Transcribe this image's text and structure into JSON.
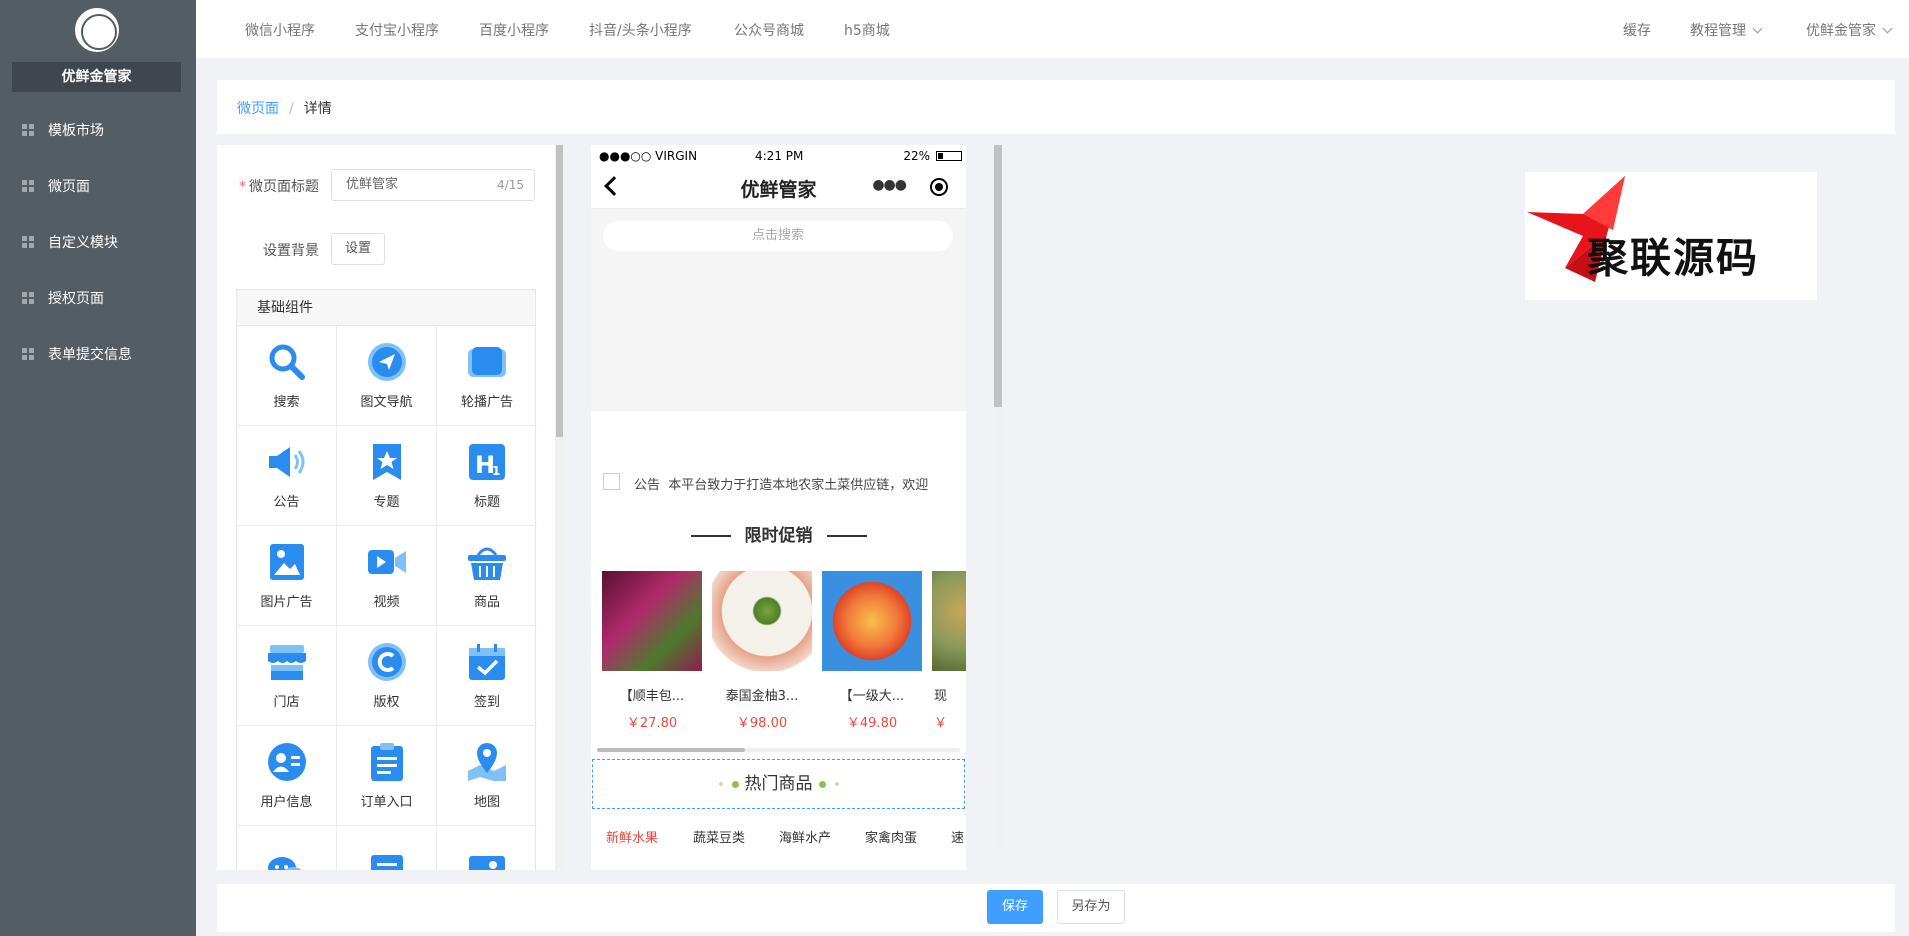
{
  "app": {
    "name": "优鲜金管家"
  },
  "sidebar": {
    "items": [
      {
        "label": "模板市场",
        "icon": "grid-icon"
      },
      {
        "label": "微页面",
        "icon": "grid-icon"
      },
      {
        "label": "自定义模块",
        "icon": "grid-icon"
      },
      {
        "label": "授权页面",
        "icon": "grid-icon"
      },
      {
        "label": "表单提交信息",
        "icon": "grid-icon"
      }
    ]
  },
  "topbar": {
    "tabs": [
      "微信小程序",
      "支付宝小程序",
      "百度小程序",
      "抖音/头条小程序",
      "公众号商城",
      "h5商城"
    ],
    "cache": "缓存",
    "tutorial": "教程管理",
    "user": "优鲜金管家"
  },
  "breadcrumb": {
    "parent": "微页面",
    "separator": "/",
    "current": "详情"
  },
  "form": {
    "title_label": "微页面标题",
    "title_value": "优鲜管家",
    "title_count": "4/15",
    "bg_label": "设置背景",
    "bg_button": "设置"
  },
  "components": {
    "header": "基础组件",
    "items": [
      {
        "label": "搜索",
        "icon": "search-icon"
      },
      {
        "label": "图文导航",
        "icon": "navigation-icon"
      },
      {
        "label": "轮播广告",
        "icon": "carousel-icon"
      },
      {
        "label": "公告",
        "icon": "speaker-icon"
      },
      {
        "label": "专题",
        "icon": "star-icon"
      },
      {
        "label": "标题",
        "icon": "heading-icon"
      },
      {
        "label": "图片广告",
        "icon": "image-icon"
      },
      {
        "label": "视频",
        "icon": "video-icon"
      },
      {
        "label": "商品",
        "icon": "basket-icon"
      },
      {
        "label": "门店",
        "icon": "store-icon"
      },
      {
        "label": "版权",
        "icon": "copyright-icon"
      },
      {
        "label": "签到",
        "icon": "calendar-check-icon"
      },
      {
        "label": "用户信息",
        "icon": "user-icon"
      },
      {
        "label": "订单入口",
        "icon": "clipboard-icon"
      },
      {
        "label": "地图",
        "icon": "map-pin-icon"
      },
      {
        "label": "",
        "icon": "chat-icon"
      },
      {
        "label": "",
        "icon": "document-icon"
      },
      {
        "label": "",
        "icon": "picture-icon"
      }
    ]
  },
  "phone": {
    "status": {
      "carrier": "●●●○○ VIRGIN",
      "time": "4:21 PM",
      "battery": "22%"
    },
    "nav_title": "优鲜管家",
    "search_placeholder": "点击搜索",
    "notice": {
      "label": "公告",
      "text": "本平台致力于打造本地农家土菜供应链，欢迎"
    },
    "promo_title": "限时促销",
    "goods": [
      {
        "name": "【顺丰包...",
        "price": "￥27.80",
        "color": "#8e1d4d"
      },
      {
        "name": "泰国金柚3...",
        "price": "￥98.00",
        "color": "#e9c9a0"
      },
      {
        "name": "【一级大...",
        "price": "￥49.80",
        "color": "#f27a3c"
      },
      {
        "name": "现",
        "price": "￥",
        "color": "#8a9a5b"
      }
    ],
    "hot_title": "热门商品",
    "categories": [
      "新鲜水果",
      "蔬菜豆类",
      "海鲜水产",
      "家禽肉蛋",
      "速"
    ]
  },
  "watermark": {
    "text": "聚联源码"
  },
  "actions": {
    "save": "保存",
    "save_as": "另存为"
  },
  "colors": {
    "sidebar": "#545c64",
    "primary": "#409eff",
    "price": "#f0483e"
  }
}
